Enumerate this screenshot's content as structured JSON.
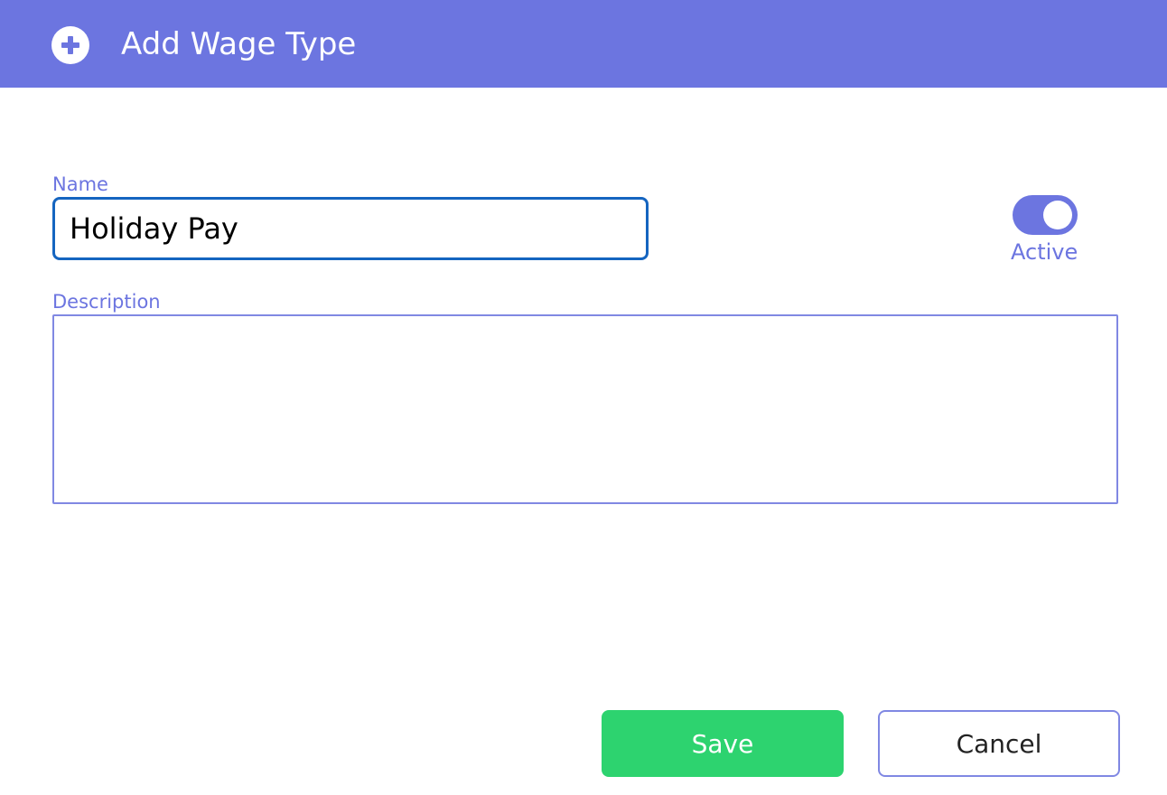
{
  "header": {
    "title": "Add Wage Type",
    "icon": "plus-circle-icon",
    "background_color": "#6c75e0"
  },
  "form": {
    "name_label": "Name",
    "name_value": "Holiday Pay",
    "description_label": "Description",
    "description_value": "",
    "active_label": "Active",
    "active_on": true
  },
  "buttons": {
    "save_label": "Save",
    "cancel_label": "Cancel"
  },
  "colors": {
    "accent": "#6c75e0",
    "save": "#2dd36f",
    "focus_border": "#1565c0"
  }
}
